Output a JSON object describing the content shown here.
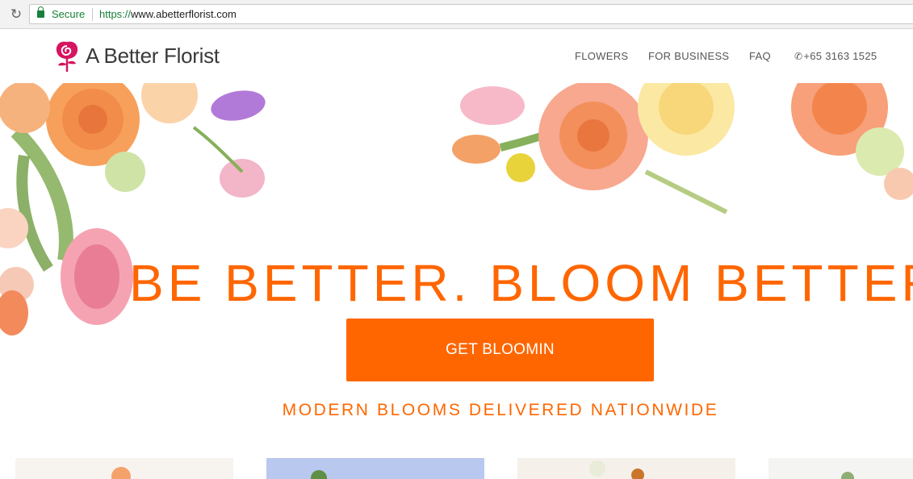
{
  "browser": {
    "secure_label": "Secure",
    "url_scheme": "https://",
    "url_rest": "www.abetterflorist.com"
  },
  "header": {
    "logo_text": "A Better Florist",
    "nav": {
      "flowers": "FLOWERS",
      "business": "FOR BUSINESS",
      "faq": "FAQ",
      "phone": "+65 3163 1525"
    }
  },
  "hero": {
    "headline": "BE BETTER. BLOOM BETTER.",
    "cta_label": "GET BLOOMIN",
    "tagline": "MODERN BLOOMS DELIVERED NATIONWIDE"
  },
  "colors": {
    "accent": "#ff6600",
    "logo_rose": "#d6145f",
    "secure_green": "#188038"
  },
  "icons": {
    "reload": "reload-icon",
    "lock": "lock-icon",
    "phone": "phone-icon",
    "logo": "rose-logo-icon"
  }
}
